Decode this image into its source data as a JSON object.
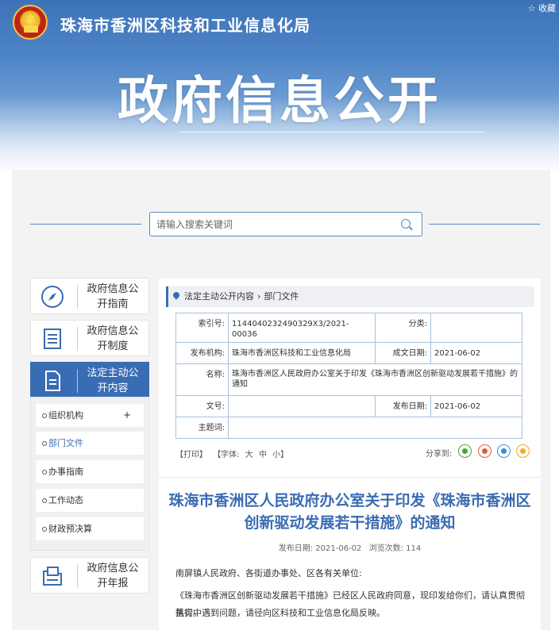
{
  "header": {
    "org_name": "珠海市香洲区科技和工业信息化局",
    "favorite": "☆ 收藏",
    "banner_title": "政府信息公开"
  },
  "search": {
    "placeholder": "请输入搜索关键词"
  },
  "sidebar": {
    "items": [
      {
        "label": "政府信息公开指南",
        "icon": "compass-icon",
        "active": false
      },
      {
        "label": "政府信息公开制度",
        "icon": "document-list-icon",
        "active": false
      },
      {
        "label": "法定主动公开内容",
        "icon": "file-icon",
        "active": true
      },
      {
        "label": "政府信息公开年报",
        "icon": "folder-report-icon",
        "active": false
      }
    ],
    "subitems": [
      {
        "label": "组织机构",
        "expand": "+"
      },
      {
        "label": "部门文件",
        "expand": ""
      },
      {
        "label": "办事指南",
        "expand": ""
      },
      {
        "label": "工作动态",
        "expand": ""
      },
      {
        "label": "财政预决算",
        "expand": ""
      }
    ]
  },
  "breadcrumb": {
    "home": "法定主动公开内容",
    "sep": "›",
    "current": "部门文件"
  },
  "meta_table": {
    "index_label": "索引号:",
    "index_value": "1144040232490329X3/2021-00036",
    "category_label": "分类:",
    "category_value": "",
    "publisher_label": "发布机构:",
    "publisher_value": "珠海市香洲区科技和工业信息化局",
    "created_label": "成文日期:",
    "created_value": "2021-06-02",
    "name_label": "名称:",
    "name_value": "珠海市香洲区人民政府办公室关于印发《珠海市香洲区创新驱动发展若干措施》的通知",
    "docno_label": "文号:",
    "docno_value": "",
    "published_label": "发布日期:",
    "published_value": "2021-06-02",
    "subject_label": "主题词:",
    "subject_value": ""
  },
  "tools": {
    "print": "【打印】",
    "font_label": "【字体:",
    "large": "大",
    "medium": "中",
    "small": "小】"
  },
  "share": {
    "label": "分享到:"
  },
  "article": {
    "title": "珠海市香洲区人民政府办公室关于印发《珠海市香洲区创新驱动发展若干措施》的通知",
    "pub_date": "发布日期: 2021-06-02",
    "views": "浏览次数: 114",
    "paragraphs": [
      "南屏镇人民政府、各街道办事处、区各有关单位:",
      "《珠海市香洲区创新驱动发展若干措施》已经区人民政府同意，现印发给你们，请认真贯彻落实。",
      "执行中遇到问题，请径向区科技和工业信息化局反映。"
    ]
  },
  "colors": {
    "accent": "#3a6cb3",
    "border": "#a9c1de"
  }
}
